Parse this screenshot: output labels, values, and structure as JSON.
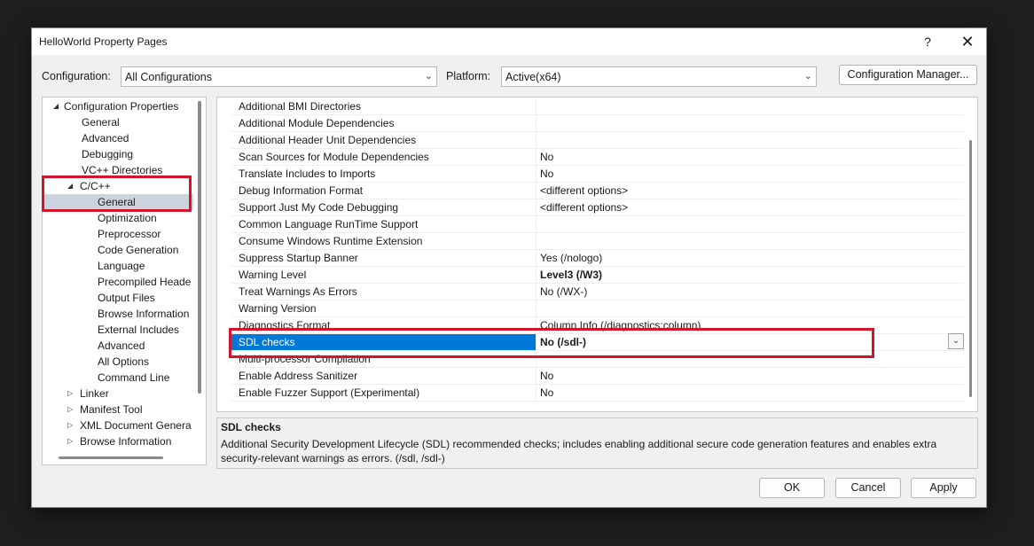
{
  "window": {
    "title": "HelloWorld Property Pages",
    "help": "?",
    "close": "✕"
  },
  "toolbar": {
    "configuration_label": "Configuration:",
    "configuration_value": "All Configurations",
    "platform_label": "Platform:",
    "platform_value": "Active(x64)",
    "config_manager_label": "Configuration Manager..."
  },
  "tree": {
    "items": [
      {
        "label": "Configuration Properties",
        "arrow": "◢"
      },
      {
        "label": "General"
      },
      {
        "label": "Advanced"
      },
      {
        "label": "Debugging"
      },
      {
        "label": "VC++ Directories"
      },
      {
        "label": "C/C++",
        "arrow": "◢"
      },
      {
        "label": "General"
      },
      {
        "label": "Optimization"
      },
      {
        "label": "Preprocessor"
      },
      {
        "label": "Code Generation"
      },
      {
        "label": "Language"
      },
      {
        "label": "Precompiled Heade"
      },
      {
        "label": "Output Files"
      },
      {
        "label": "Browse Information"
      },
      {
        "label": "External Includes"
      },
      {
        "label": "Advanced"
      },
      {
        "label": "All Options"
      },
      {
        "label": "Command Line"
      },
      {
        "label": "Linker",
        "arrow": "▷"
      },
      {
        "label": "Manifest Tool",
        "arrow": "▷"
      },
      {
        "label": "XML Document Genera",
        "arrow": "▷"
      },
      {
        "label": "Browse Information",
        "arrow": "▷"
      }
    ]
  },
  "properties": [
    {
      "name": "Additional BMI Directories",
      "value": ""
    },
    {
      "name": "Additional Module Dependencies",
      "value": ""
    },
    {
      "name": "Additional Header Unit Dependencies",
      "value": ""
    },
    {
      "name": "Scan Sources for Module Dependencies",
      "value": "No"
    },
    {
      "name": "Translate Includes to Imports",
      "value": "No"
    },
    {
      "name": "Debug Information Format",
      "value": "<different options>"
    },
    {
      "name": "Support Just My Code Debugging",
      "value": "<different options>"
    },
    {
      "name": "Common Language RunTime Support",
      "value": ""
    },
    {
      "name": "Consume Windows Runtime Extension",
      "value": ""
    },
    {
      "name": "Suppress Startup Banner",
      "value": "Yes (/nologo)"
    },
    {
      "name": "Warning Level",
      "value": "Level3 (/W3)"
    },
    {
      "name": "Treat Warnings As Errors",
      "value": "No (/WX-)"
    },
    {
      "name": "Warning Version",
      "value": ""
    },
    {
      "name": "Diagnostics Format",
      "value": "Column Info (/diagnostics:column)"
    },
    {
      "name": "SDL checks",
      "value": "No (/sdl-)"
    },
    {
      "name": "Multi-processor Compilation",
      "value": ""
    },
    {
      "name": "Enable Address Sanitizer",
      "value": "No"
    },
    {
      "name": "Enable Fuzzer Support (Experimental)",
      "value": "No"
    }
  ],
  "dropdown_arrow": "⌄",
  "description": {
    "title": "SDL checks",
    "text": "Additional Security Development Lifecycle (SDL) recommended checks; includes enabling additional secure code generation features and enables extra security-relevant warnings as errors.     (/sdl, /sdl-)"
  },
  "buttons": {
    "ok": "OK",
    "cancel": "Cancel",
    "apply": "Apply"
  },
  "colors": {
    "selection": "#0078d7",
    "highlight_box": "#d4142a",
    "tree_selection": "#cdd3de"
  }
}
